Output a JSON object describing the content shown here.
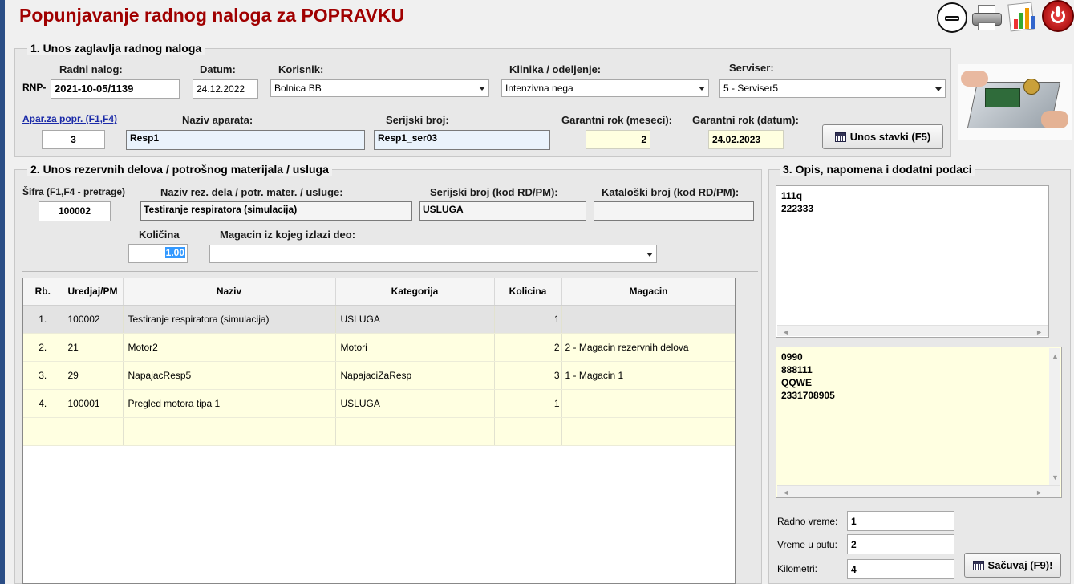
{
  "window": {
    "title": "Popunjavanje radnog naloga za POPRAVKU"
  },
  "header_icons": [
    "minimize-icon",
    "printer-icon",
    "report-chart-icon",
    "power-icon"
  ],
  "section1": {
    "title": "1. Unos zaglavlja radnog naloga",
    "radni_nalog_label": "Radni nalog:",
    "rnp_prefix": "RNP-",
    "radni_nalog_value": "2021-10-05/1139",
    "datum_label": "Datum:",
    "datum_value": "24.12.2022",
    "korisnik_label": "Korisnik:",
    "korisnik_value": "Bolnica BB",
    "klinika_label": "Klinika / odeljenje:",
    "klinika_value": "Intenzivna nega",
    "serviser_label": "Serviser:",
    "serviser_value": "5 - Serviser5",
    "aparat_link": "Apar.za popr. (F1,F4)",
    "aparat_value": "3",
    "naziv_label": "Naziv aparata:",
    "naziv_value": "Resp1",
    "serijski_label": "Serijski broj:",
    "serijski_value": "Resp1_ser03",
    "garantni_meseci_label": "Garantni rok (meseci):",
    "garantni_meseci_value": "2",
    "garantni_datum_label": "Garantni rok (datum):",
    "garantni_datum_value": "24.02.2023",
    "unos_stavki_button": "Unos stavki (F5)"
  },
  "section2": {
    "title": "2. Unos rezervnih delova / potrošnog materijala / usluga",
    "sifra_label": "Šifra (F1,F4 - pretrage)",
    "sifra_value": "100002",
    "naziv_label": "Naziv rez. dela / potr. mater. / usluge:",
    "naziv_value": "Testiranje respiratora (simulacija)",
    "serijski_label": "Serijski broj (kod RD/PM):",
    "serijski_value": "USLUGA",
    "katalog_label": "Kataloški broj (kod RD/PM):",
    "katalog_value": "",
    "kolicina_label": "Količina",
    "kolicina_value": "1.00",
    "magacin_label": "Magacin iz kojeg izlazi deo:",
    "magacin_value": "",
    "table": {
      "columns": [
        "Rb.",
        "Uredjaj/PM",
        "Naziv",
        "Kategorija",
        "Kolicina",
        "Magacin"
      ],
      "rows": [
        {
          "rb": "1.",
          "uredjaj": "100002",
          "naziv": "Testiranje respiratora (simulacija)",
          "kategorija": "USLUGA",
          "kolicina": "1",
          "magacin": ""
        },
        {
          "rb": "2.",
          "uredjaj": "21",
          "naziv": "Motor2",
          "kategorija": "Motori",
          "kolicina": "2",
          "magacin": "2 - Magacin rezervnih delova"
        },
        {
          "rb": "3.",
          "uredjaj": "29",
          "naziv": "NapajacResp5",
          "kategorija": "NapajaciZaResp",
          "kolicina": "3",
          "magacin": "1 - Magacin 1"
        },
        {
          "rb": "4.",
          "uredjaj": "100001",
          "naziv": "Pregled motora tipa 1",
          "kategorija": "USLUGA",
          "kolicina": "1",
          "magacin": ""
        }
      ]
    }
  },
  "section3": {
    "title": "3. Opis, napomena i dodatni podaci",
    "opis_text": "111q\n222333",
    "napomena_text": "0990\n888111\nQQWE\n2331708905",
    "radno_vreme_label": "Radno vreme:",
    "radno_vreme_value": "1",
    "vreme_u_putu_label": "Vreme u putu:",
    "vreme_u_putu_value": "2",
    "kilometri_label": "Kilometri:",
    "kilometri_value": "4",
    "sacuvaj_button": "Sačuvaj (F9)!"
  },
  "colors": {
    "title_red": "#a00000",
    "link_blue": "#1a2aa8",
    "selection_blue": "#3399ff",
    "row_yellow": "#ffffe1"
  }
}
